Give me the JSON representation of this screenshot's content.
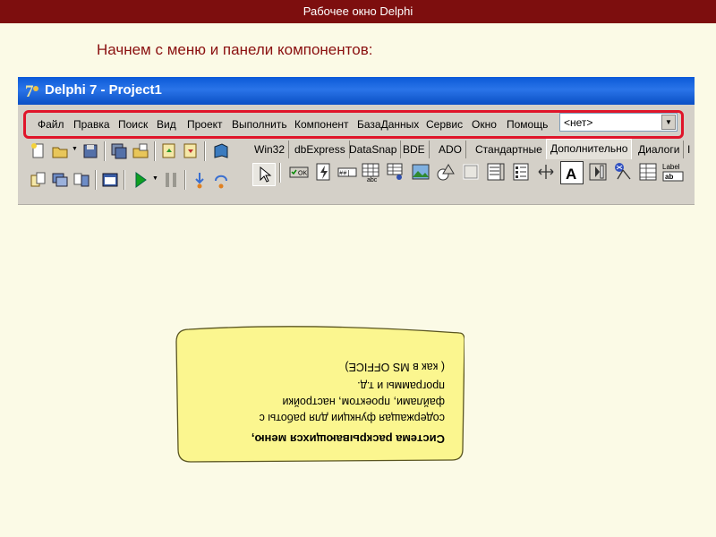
{
  "slide": {
    "header": "Рабочее окно Delphi",
    "heading": "Начнем с меню и панели компонентов:"
  },
  "window": {
    "title": "Delphi 7 - Project1"
  },
  "menu": {
    "items": [
      "Файл",
      "Правка",
      "Поиск",
      "Вид",
      "Проект",
      "Выполнить",
      "Компонент",
      "БазаДанных",
      "Сервис",
      "Окно",
      "Помощь"
    ],
    "combo_value": "<нет>"
  },
  "palette_tabs": [
    "Win32",
    "dbExpress",
    "DataSnap",
    "BDE",
    "ADO",
    "Стандартные",
    "Дополнительно",
    "Диалоги",
    "I"
  ],
  "palette_active_tab": "Дополнительно",
  "palette_glyphs": {
    "ok_label": "OK",
    "abc_label": "abc",
    "a_label": "A",
    "label_caption": "Label",
    "ab_caption": "ab"
  },
  "note": {
    "title": "Система раскрывающихся меню,",
    "lines": [
      "содержащая функции для работы с",
      "файлами, проектом, настройки",
      "программы и т.д.",
      "( как   в MS OFFICE)"
    ]
  },
  "colors": {
    "header_bg": "#7d0e0e",
    "heading_text": "#8a1010",
    "highlight": "#e0152a",
    "note_bg": "#fbf68f",
    "titlebar": "#0b59d8"
  }
}
